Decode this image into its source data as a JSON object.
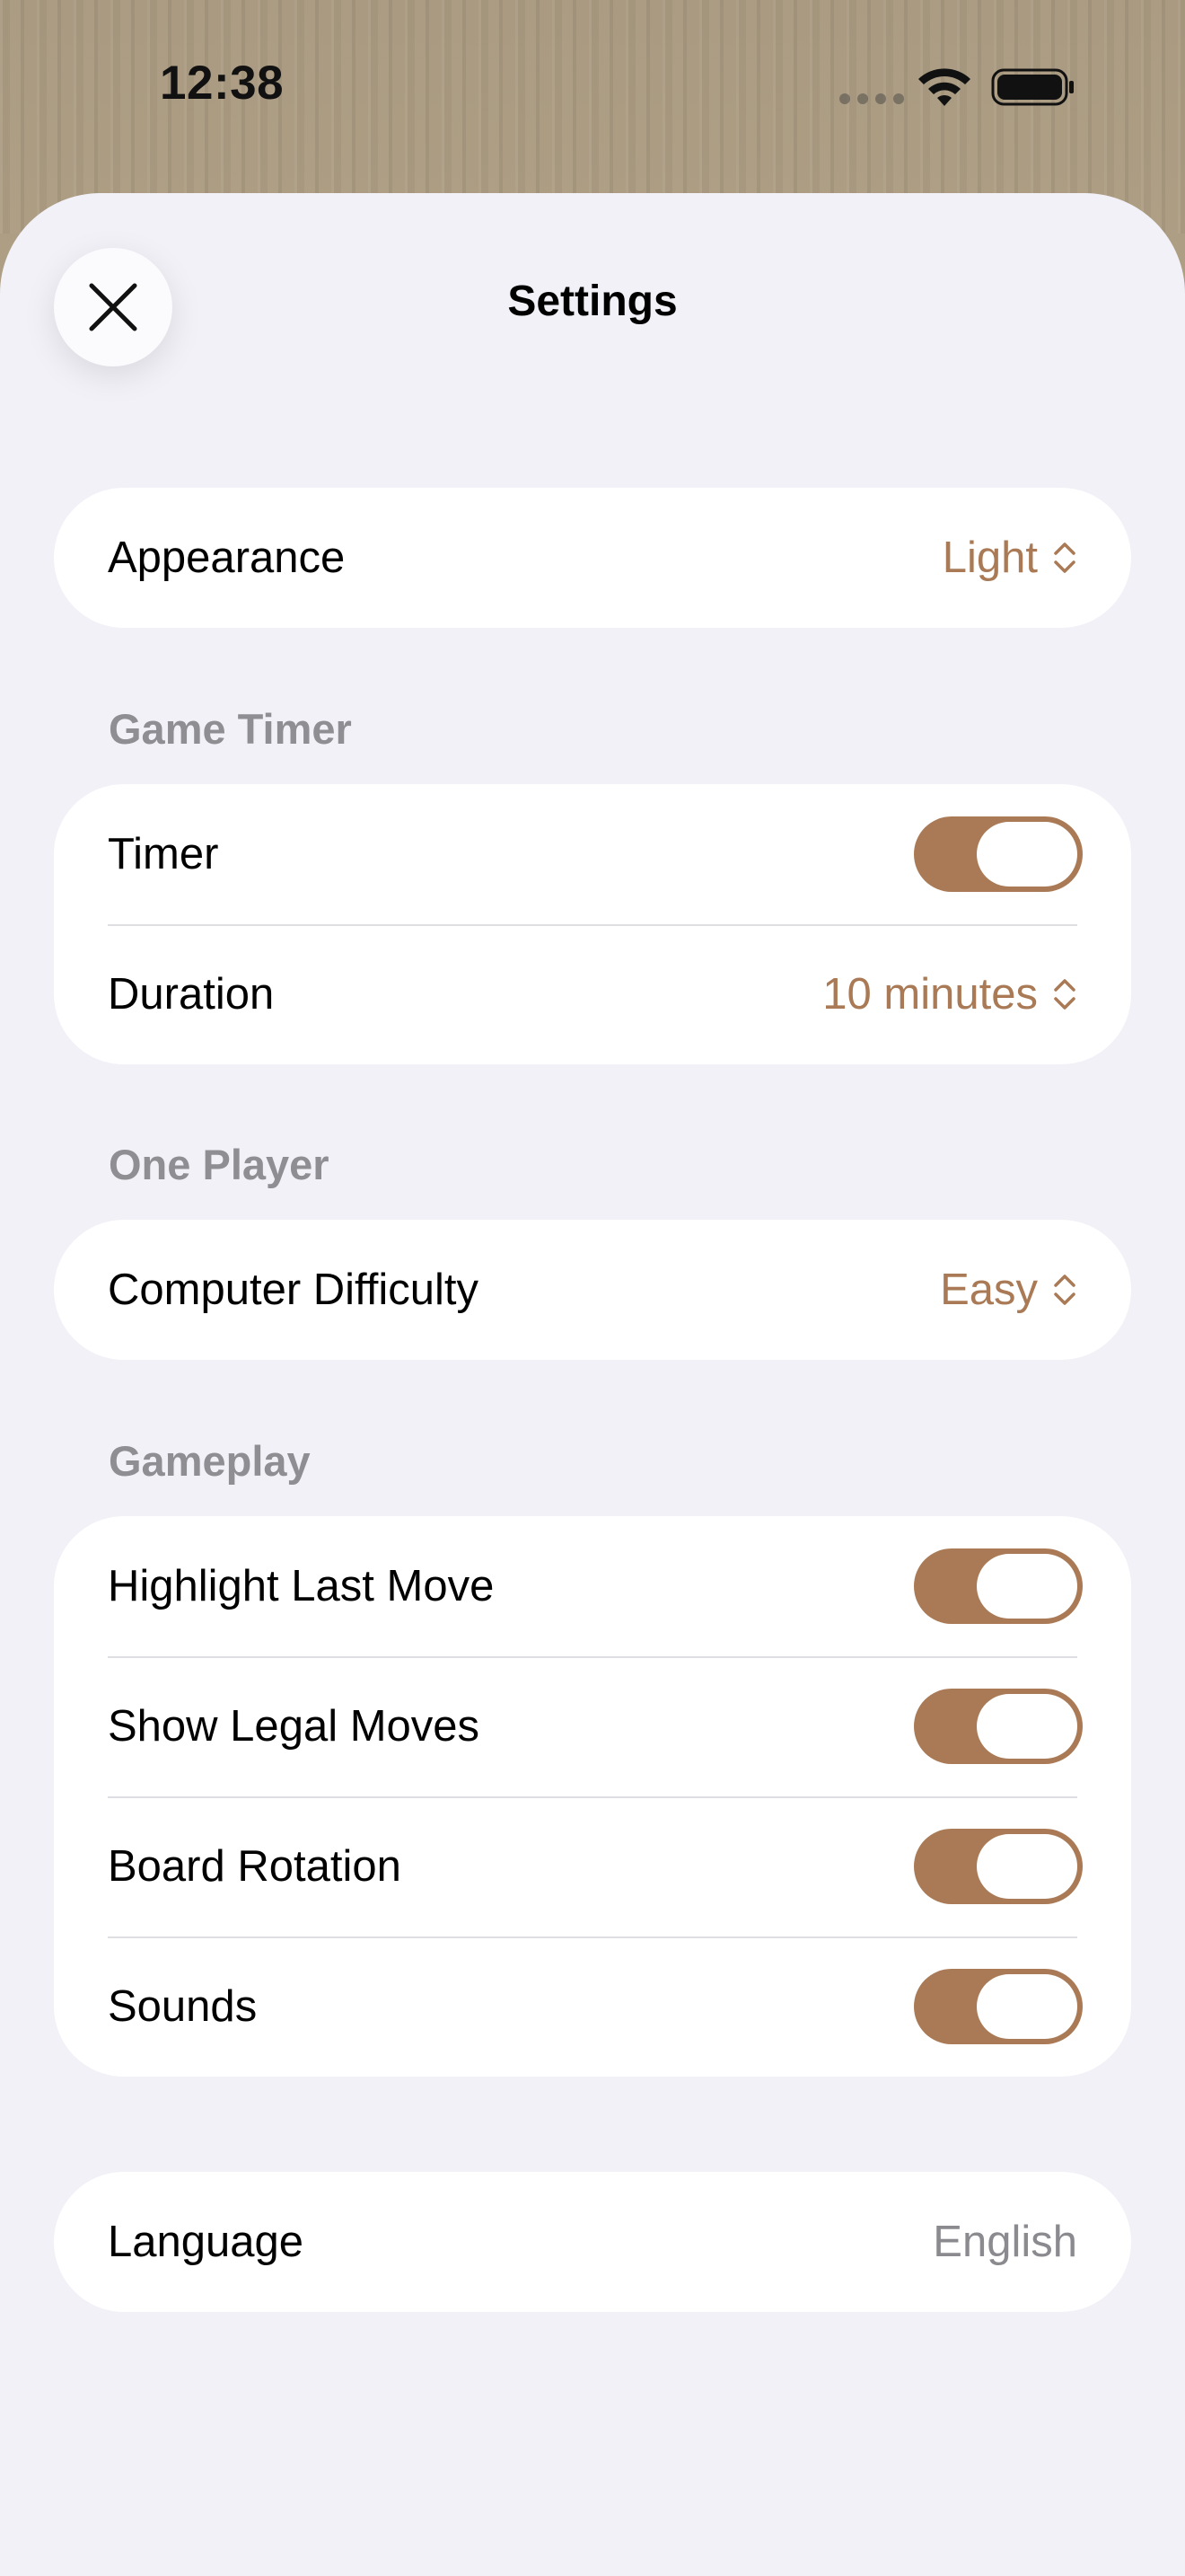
{
  "status_bar": {
    "time": "12:38"
  },
  "sheet": {
    "title": "Settings"
  },
  "appearance": {
    "label": "Appearance",
    "value": "Light"
  },
  "game_timer": {
    "header": "Game Timer",
    "timer_label": "Timer",
    "timer_on": true,
    "duration_label": "Duration",
    "duration_value": "10 minutes"
  },
  "one_player": {
    "header": "One Player",
    "difficulty_label": "Computer Difficulty",
    "difficulty_value": "Easy"
  },
  "gameplay": {
    "header": "Gameplay",
    "items": [
      {
        "label": "Highlight Last Move",
        "on": true
      },
      {
        "label": "Show Legal Moves",
        "on": true
      },
      {
        "label": "Board Rotation",
        "on": true
      },
      {
        "label": "Sounds",
        "on": true
      }
    ]
  },
  "language": {
    "label": "Language",
    "value": "English"
  },
  "colors": {
    "accent": "#a97a55",
    "background": "#f1f1f7",
    "section_header": "#8e8e93"
  },
  "icons": {
    "close": "close-icon",
    "chevron": "chevron-up-down-icon",
    "wifi": "wifi-icon",
    "battery": "battery-icon"
  }
}
